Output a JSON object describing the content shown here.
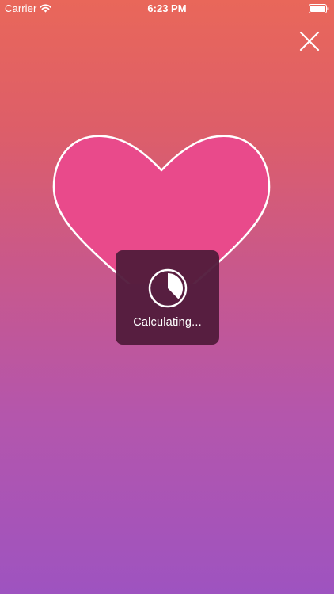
{
  "status_bar": {
    "carrier": "Carrier",
    "time": "6:23 PM",
    "wifi_icon": "wifi-icon",
    "battery_icon": "battery-icon"
  },
  "close_button": {
    "icon": "close-icon"
  },
  "heart": {
    "icon": "heart-icon",
    "fill_color": "#E94A8B",
    "stroke_color": "#FFFFFF"
  },
  "hud": {
    "label": "Calculating...",
    "icon": "progress-pie-icon",
    "progress": 0.375,
    "background_color": "#521C3C"
  },
  "colors": {
    "gradient_top": "#E9675A",
    "gradient_bottom": "#9E53C0"
  }
}
